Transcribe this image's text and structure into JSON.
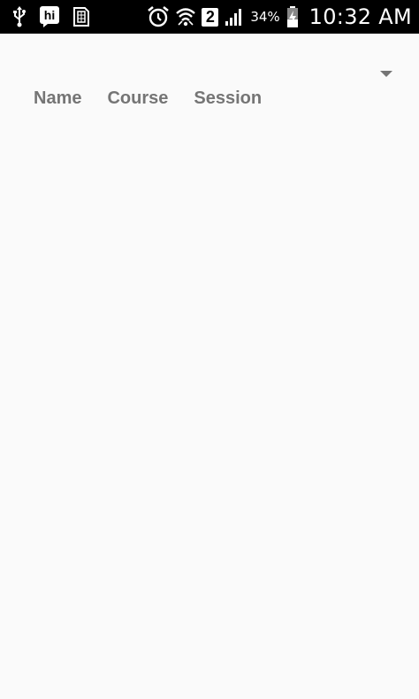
{
  "status_bar": {
    "icons_left": [
      "usb-icon",
      "hike-icon",
      "sim-toolkit-icon"
    ],
    "icons_right": [
      "alarm-icon",
      "wifi-icon",
      "sim-2-icon",
      "signal-icon",
      "battery-charging-icon"
    ],
    "sim_number": "2",
    "battery_percent": "34%",
    "time": "10:32 AM"
  },
  "spinner": {
    "icon": "dropdown-arrow-icon"
  },
  "table_header": {
    "columns": [
      "Name",
      "Course",
      "Session"
    ]
  },
  "colors": {
    "status_bar_bg": "#000000",
    "page_bg": "#fafafa",
    "header_text": "#757575",
    "arrow": "#757575"
  }
}
